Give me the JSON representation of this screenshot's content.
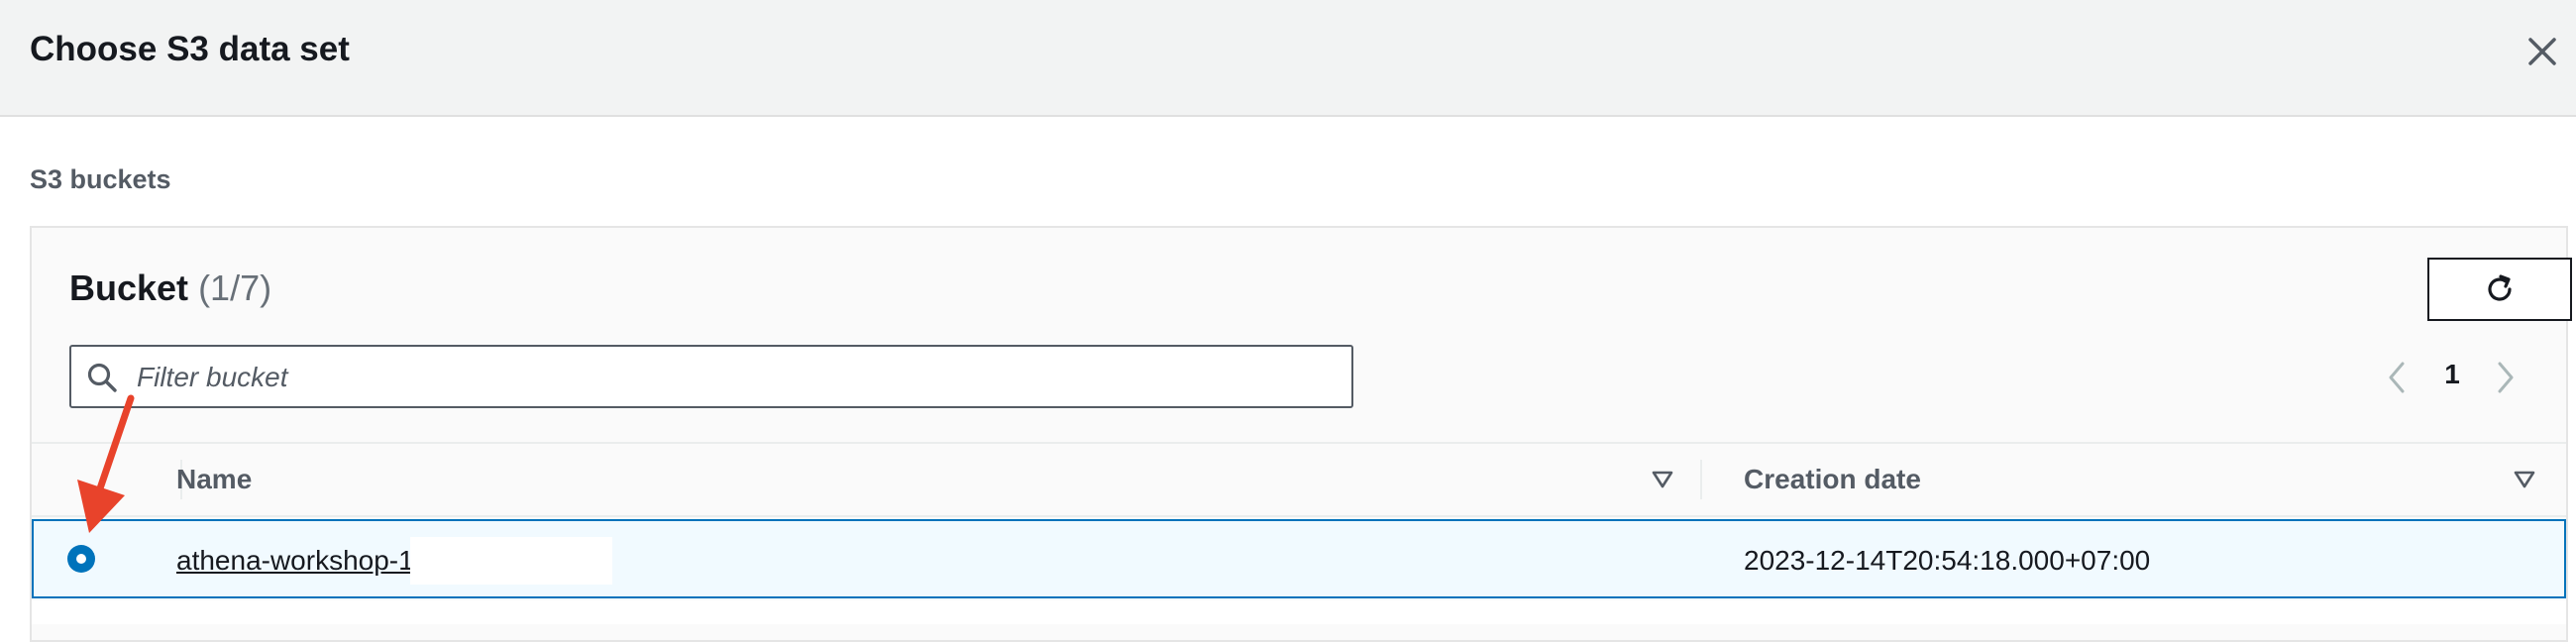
{
  "modal": {
    "title": "Choose S3 data set"
  },
  "section": {
    "label": "S3 buckets"
  },
  "bucket_panel": {
    "title": "Bucket",
    "count": "(1/7)"
  },
  "search": {
    "placeholder": "Filter bucket",
    "value": ""
  },
  "pagination": {
    "current_page": "1"
  },
  "table": {
    "columns": [
      "Name",
      "Creation date"
    ],
    "rows": [
      {
        "name": "athena-workshop-1",
        "creation_date": "2023-12-14T20:54:18.000+07:00",
        "selected": true
      }
    ]
  },
  "colors": {
    "accent": "#0073bb",
    "selected_row_bg": "#f1faff",
    "header_bg": "#f2f3f3",
    "annotation_arrow": "#e8432b"
  },
  "icons": {
    "close": "close-icon",
    "refresh": "refresh-icon",
    "search": "search-icon",
    "prev": "chevron-left-icon",
    "next": "chevron-right-icon",
    "sort": "sort-down-icon"
  }
}
